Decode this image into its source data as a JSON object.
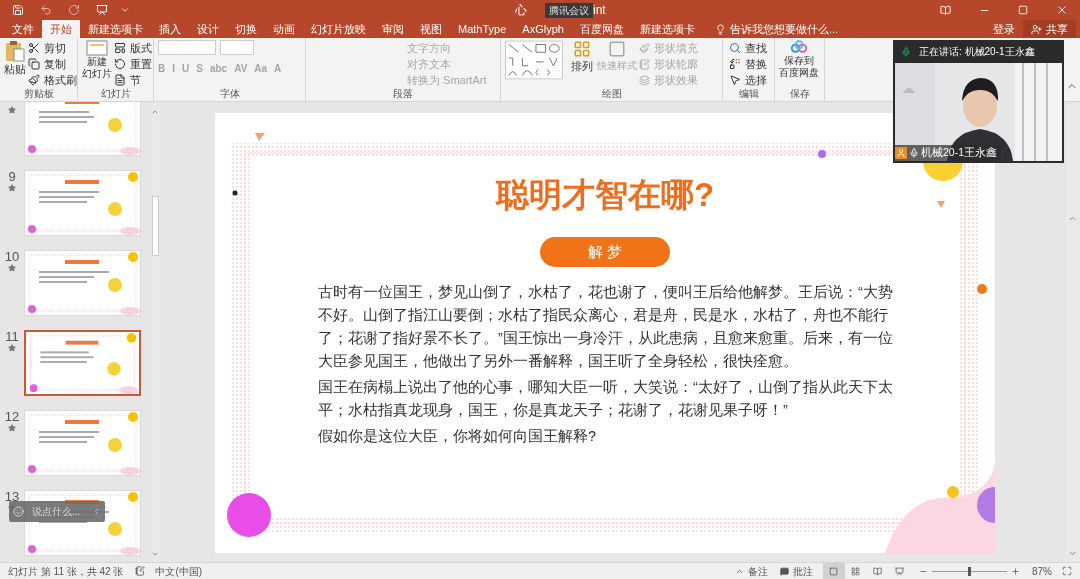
{
  "title_bar": {
    "title_start": "心",
    "overlay_label": "腾讯会议",
    "title_end": "int"
  },
  "tabs": [
    {
      "label": "文件",
      "selected": false
    },
    {
      "label": "开始",
      "selected": true
    },
    {
      "label": "新建选项卡",
      "selected": false
    },
    {
      "label": "插入",
      "selected": false
    },
    {
      "label": "设计",
      "selected": false
    },
    {
      "label": "切换",
      "selected": false
    },
    {
      "label": "动画",
      "selected": false
    },
    {
      "label": "幻灯片放映",
      "selected": false
    },
    {
      "label": "审阅",
      "selected": false
    },
    {
      "label": "视图",
      "selected": false
    },
    {
      "label": "MathType",
      "selected": false
    },
    {
      "label": "AxGlyph",
      "selected": false
    },
    {
      "label": "百度网盘",
      "selected": false
    },
    {
      "label": "新建选项卡",
      "selected": false
    }
  ],
  "tell_me": "告诉我您想要做什么...",
  "account": {
    "sign_in": "登录",
    "share": "共享"
  },
  "ribbon": {
    "clipboard": {
      "name": "剪贴板",
      "paste": "粘贴",
      "items": [
        {
          "label": "剪切",
          "disabled": false
        },
        {
          "label": "复制",
          "disabled": false
        },
        {
          "label": "格式刷",
          "disabled": false
        }
      ]
    },
    "slides": {
      "name": "幻灯片",
      "new_slide": [
        "新建",
        "幻灯片"
      ],
      "items": [
        {
          "label": "版式",
          "disabled": false
        },
        {
          "label": "重置",
          "disabled": false
        },
        {
          "label": "节",
          "disabled": false
        }
      ]
    },
    "font": {
      "name": "字体",
      "buttons": [
        {
          "label": "B",
          "disabled": true
        },
        {
          "label": "I",
          "disabled": true
        },
        {
          "label": "U",
          "disabled": true
        },
        {
          "label": "S",
          "disabled": true
        },
        {
          "label": "abc",
          "disabled": true
        },
        {
          "label": "AV",
          "disabled": true
        },
        {
          "label": "Aa",
          "disabled": true
        },
        {
          "label": "A",
          "disabled": true
        }
      ]
    },
    "paragraph": {
      "name": "段落",
      "items": [
        {
          "label": "文字方向",
          "disabled": true
        },
        {
          "label": "对齐文本",
          "disabled": true
        },
        {
          "label": "转换为 SmartArt",
          "disabled": true
        }
      ]
    },
    "drawing": {
      "name": "绘图",
      "arrange": "排列",
      "quick_styles": {
        "label": "快速样式",
        "disabled": true
      },
      "items": [
        {
          "label": "形状填充",
          "disabled": true
        },
        {
          "label": "形状轮廓",
          "disabled": true
        },
        {
          "label": "形状效果",
          "disabled": true
        }
      ]
    },
    "editing": {
      "name": "编辑",
      "items": [
        {
          "label": "查找",
          "disabled": false
        },
        {
          "label": "替换",
          "disabled": false
        },
        {
          "label": "选择",
          "disabled": false
        }
      ]
    },
    "save": {
      "name": "保存",
      "button": [
        "保存到",
        "百度网盘"
      ]
    }
  },
  "thumbnails": [
    {
      "selected": false
    },
    {
      "number": "9",
      "selected": false
    },
    {
      "number": "10",
      "selected": false
    },
    {
      "number": "11",
      "selected": true
    },
    {
      "number": "12",
      "selected": false
    },
    {
      "number": "13",
      "selected": false
    }
  ],
  "chat_bar": {
    "placeholder": "说点什么..."
  },
  "slide": {
    "title": "聪明才智在哪?",
    "pill": "解 梦",
    "paragraphs": [
      "古时有一位国王，梦见山倒了，水枯了，花也谢了，便叫王后给他解梦。王后说：“大势不好。山倒了指江山要倒；水枯了指民众离心，君是舟，民是水，水枯了，舟也不能行了；花谢了指好景不长了。”国王惊出一身冷汗，从此患病，且愈来愈重。后来，有一位大臣参见国王，他做出了另外一番解释，国王听了全身轻松，很快痊愈。",
      "国王在病榻上说出了他的心事，哪知大臣一听，大笑说：“太好了，山倒了指从此天下太平；水枯指真龙现身，国王，你是真龙天子；花谢了，花谢见果子呀！”",
      "假如你是这位大臣，你将如何向国王解释?"
    ]
  },
  "video": {
    "speaking": "正在讲话: 机械20-1王永鑫",
    "name": "机械20-1王永鑫"
  },
  "status_bar": {
    "slide_info": "幻灯片 第 11 张，共 42 张",
    "language": "中文(中国)",
    "notes": "备注",
    "comments": "批注",
    "views": [
      {
        "selected": true
      },
      {
        "selected": false
      },
      {
        "selected": false
      },
      {
        "selected": false
      }
    ],
    "zoom": {
      "level": 0.5,
      "reading": "87%"
    }
  }
}
